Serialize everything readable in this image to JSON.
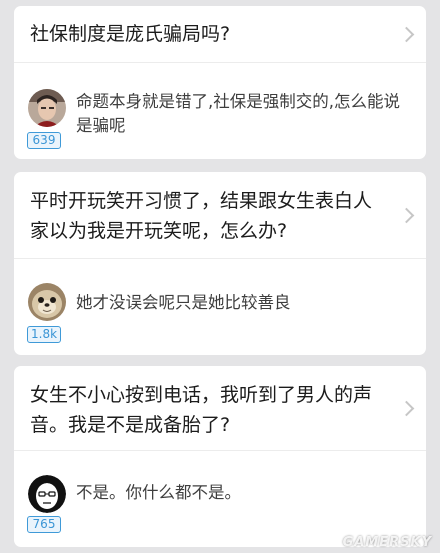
{
  "cards": [
    {
      "question": "社保制度是庞氏骗局吗?",
      "answer": "命题本身就是错了,社保是强制交的,怎么能说是骗呢",
      "votes": "639",
      "avatar_icon": "user-photo-avatar-icon"
    },
    {
      "question": "平时开玩笑开习惯了，结果跟女生表白人家以为我是开玩笑呢，怎么办?",
      "answer": "她才没误会呢只是她比较善良",
      "votes": "1.8k",
      "avatar_icon": "seal-avatar-icon"
    },
    {
      "question": "女生不小心按到电话，我听到了男人的声音。我是不是成备胎了?",
      "answer": "不是。你什么都不是。",
      "votes": "765",
      "avatar_icon": "sketch-face-avatar-icon"
    }
  ],
  "colors": {
    "background": "#e4e4e6",
    "card": "#ffffff",
    "vote_accent": "#3a95d5",
    "question_text": "#1c1c1c",
    "answer_text": "#3e3e3e"
  }
}
